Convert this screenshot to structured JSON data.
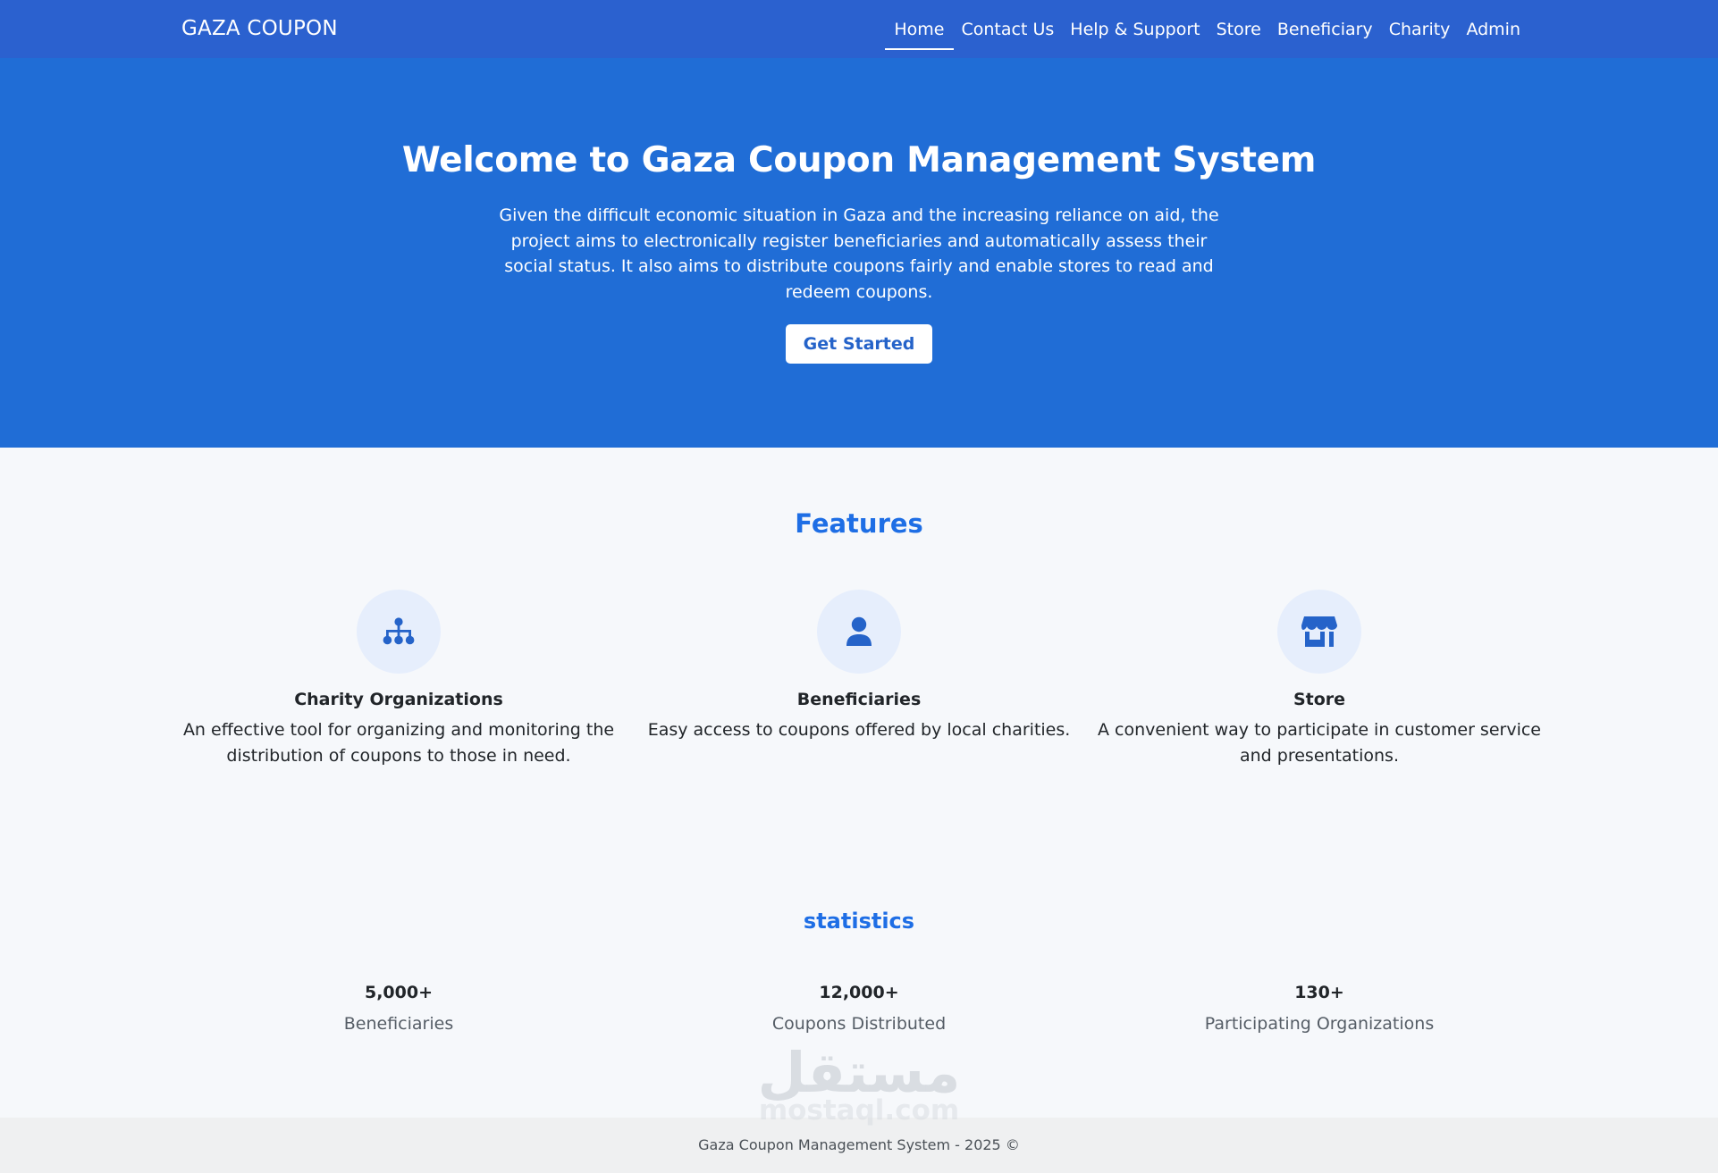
{
  "navbar": {
    "brand": "GAZA COUPON",
    "links": [
      {
        "label": "Home",
        "active": true
      },
      {
        "label": "Contact Us"
      },
      {
        "label": "Help & Support"
      },
      {
        "label": "Store"
      },
      {
        "label": "Beneficiary"
      },
      {
        "label": "Charity"
      },
      {
        "label": "Admin"
      }
    ]
  },
  "hero": {
    "title": "Welcome to Gaza Coupon Management System",
    "description": "Given the difficult economic situation in Gaza and the increasing reliance on aid, the project aims to electronically register beneficiaries and automatically assess their social status. It also aims to distribute coupons fairly and enable stores to read and redeem coupons.",
    "button_label": "Get Started"
  },
  "features": {
    "title": "Features",
    "items": [
      {
        "icon": "sitemap-icon",
        "title": "Charity Organizations",
        "text": "An effective tool for organizing and monitoring the distribution of coupons to those in need."
      },
      {
        "icon": "user-icon",
        "title": "Beneficiaries",
        "text": "Easy access to coupons offered by local charities."
      },
      {
        "icon": "store-icon",
        "title": "Store",
        "text": "A convenient way to participate in customer service and presentations."
      }
    ]
  },
  "statistics": {
    "title": "statistics",
    "items": [
      {
        "value": "5,000+",
        "label": "Beneficiaries"
      },
      {
        "value": "12,000+",
        "label": "Coupons Distributed"
      },
      {
        "value": "130+",
        "label": "Participating Organizations"
      }
    ]
  },
  "watermark": {
    "arabic": "مستقل",
    "latin": "mostaql.com"
  },
  "footer": {
    "text": "Gaza Coupon Management System - 2025 ©"
  },
  "colors": {
    "navbar": "#2b61cf",
    "hero": "#206dd6",
    "accent": "#1e6ee5",
    "icon_bg": "#e6eefc",
    "page_bg": "#f6f8fb",
    "footer_bg": "#eff0f1"
  }
}
